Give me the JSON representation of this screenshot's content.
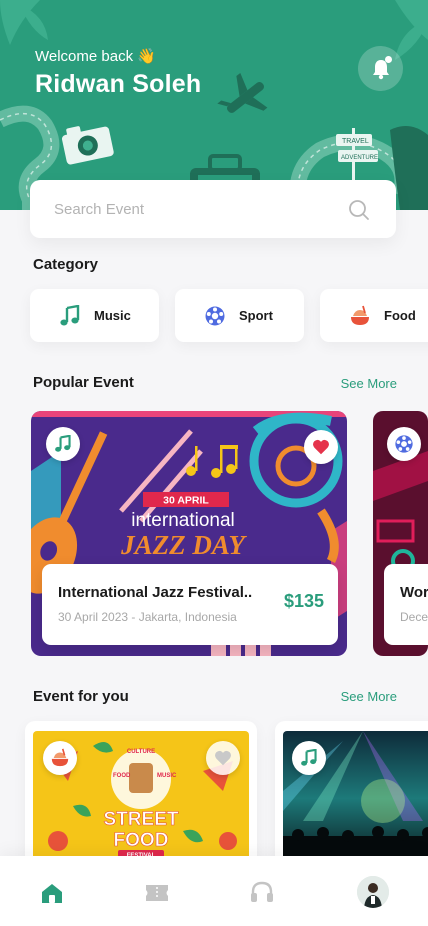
{
  "header": {
    "welcome": "Welcome back 👋",
    "user_name": "Ridwan Soleh",
    "bg_color": "#2a9d7c",
    "notification_icon": "bell-icon",
    "illustration_text_1": "TRAVEL",
    "illustration_text_2": "ADVENTURE"
  },
  "search": {
    "placeholder": "Search Event",
    "icon": "search-icon"
  },
  "category": {
    "title": "Category",
    "items": [
      {
        "label": "Music",
        "icon": "music-note-icon"
      },
      {
        "label": "Sport",
        "icon": "soccer-ball-icon"
      },
      {
        "label": "Food",
        "icon": "food-icon"
      }
    ]
  },
  "popular": {
    "title": "Popular Event",
    "see_more": "See More",
    "events": [
      {
        "banner_date": "30 APRIL",
        "banner_line1": "international",
        "banner_line2": "JAZZ DAY",
        "name": "International Jazz Festival..",
        "meta": "30 April 2023 - Jakarta, Indonesia",
        "price": "$135",
        "category_icon": "music-note-icon",
        "favorite_icon": "heart-icon"
      },
      {
        "name": "Wor",
        "meta": "Dece",
        "category_icon": "soccer-ball-icon"
      }
    ]
  },
  "for_you": {
    "title": "Event for you",
    "see_more": "See More",
    "events": [
      {
        "banner_title_1": "STREET",
        "banner_title_2": "FOOD",
        "banner_subtitle": "FESTIVAL",
        "banner_words": [
          "FOOD",
          "CULTURE",
          "MUSIC"
        ],
        "category_icon": "food-icon",
        "favorite_icon": "heart-icon"
      },
      {
        "category_icon": "music-note-icon"
      }
    ]
  },
  "nav": {
    "items": [
      {
        "icon": "home-icon",
        "active": true
      },
      {
        "icon": "ticket-icon",
        "active": false
      },
      {
        "icon": "headset-icon",
        "active": false
      },
      {
        "icon": "profile-avatar",
        "active": false
      }
    ]
  },
  "colors": {
    "accent": "#2a9d7c",
    "heart": "#e5334b",
    "jazz_bg": "#4a2a8c",
    "food_bg": "#f5c518"
  }
}
